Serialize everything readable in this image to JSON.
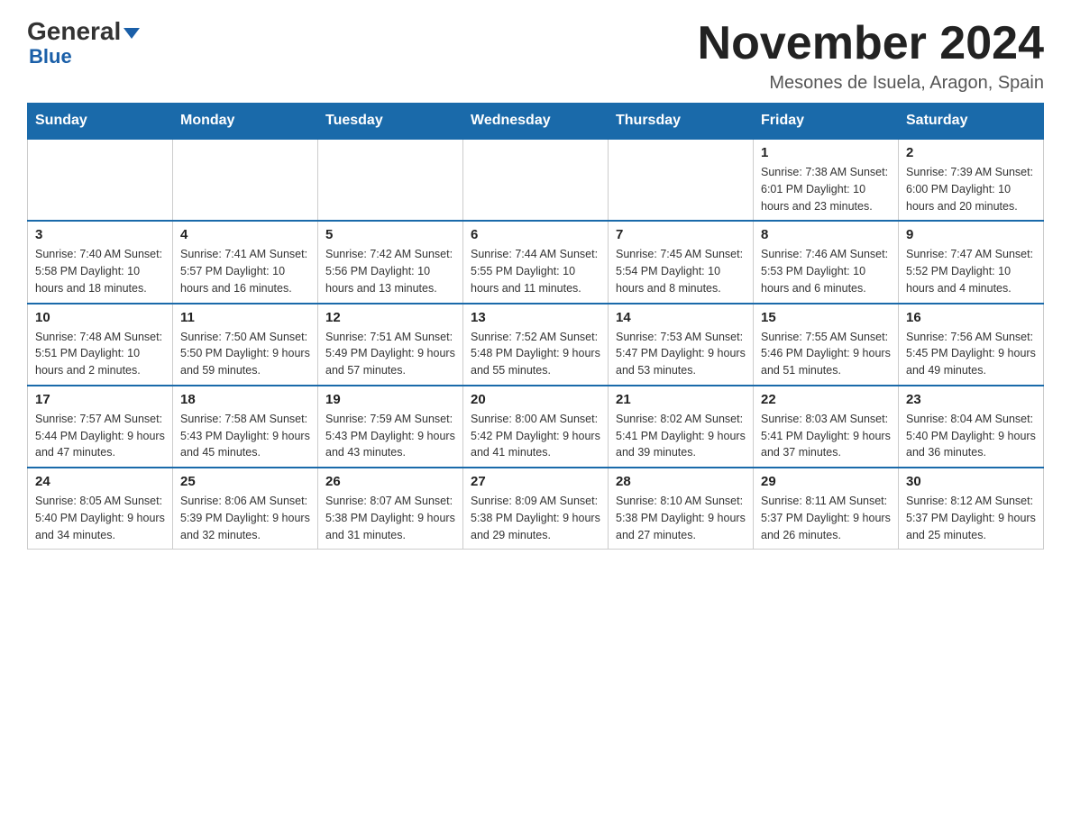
{
  "logo": {
    "top_text": "General",
    "bottom_text": "Blue"
  },
  "title": "November 2024",
  "location": "Mesones de Isuela, Aragon, Spain",
  "days_of_week": [
    "Sunday",
    "Monday",
    "Tuesday",
    "Wednesday",
    "Thursday",
    "Friday",
    "Saturday"
  ],
  "weeks": [
    [
      {
        "day": "",
        "info": ""
      },
      {
        "day": "",
        "info": ""
      },
      {
        "day": "",
        "info": ""
      },
      {
        "day": "",
        "info": ""
      },
      {
        "day": "",
        "info": ""
      },
      {
        "day": "1",
        "info": "Sunrise: 7:38 AM\nSunset: 6:01 PM\nDaylight: 10 hours and 23 minutes."
      },
      {
        "day": "2",
        "info": "Sunrise: 7:39 AM\nSunset: 6:00 PM\nDaylight: 10 hours and 20 minutes."
      }
    ],
    [
      {
        "day": "3",
        "info": "Sunrise: 7:40 AM\nSunset: 5:58 PM\nDaylight: 10 hours and 18 minutes."
      },
      {
        "day": "4",
        "info": "Sunrise: 7:41 AM\nSunset: 5:57 PM\nDaylight: 10 hours and 16 minutes."
      },
      {
        "day": "5",
        "info": "Sunrise: 7:42 AM\nSunset: 5:56 PM\nDaylight: 10 hours and 13 minutes."
      },
      {
        "day": "6",
        "info": "Sunrise: 7:44 AM\nSunset: 5:55 PM\nDaylight: 10 hours and 11 minutes."
      },
      {
        "day": "7",
        "info": "Sunrise: 7:45 AM\nSunset: 5:54 PM\nDaylight: 10 hours and 8 minutes."
      },
      {
        "day": "8",
        "info": "Sunrise: 7:46 AM\nSunset: 5:53 PM\nDaylight: 10 hours and 6 minutes."
      },
      {
        "day": "9",
        "info": "Sunrise: 7:47 AM\nSunset: 5:52 PM\nDaylight: 10 hours and 4 minutes."
      }
    ],
    [
      {
        "day": "10",
        "info": "Sunrise: 7:48 AM\nSunset: 5:51 PM\nDaylight: 10 hours and 2 minutes."
      },
      {
        "day": "11",
        "info": "Sunrise: 7:50 AM\nSunset: 5:50 PM\nDaylight: 9 hours and 59 minutes."
      },
      {
        "day": "12",
        "info": "Sunrise: 7:51 AM\nSunset: 5:49 PM\nDaylight: 9 hours and 57 minutes."
      },
      {
        "day": "13",
        "info": "Sunrise: 7:52 AM\nSunset: 5:48 PM\nDaylight: 9 hours and 55 minutes."
      },
      {
        "day": "14",
        "info": "Sunrise: 7:53 AM\nSunset: 5:47 PM\nDaylight: 9 hours and 53 minutes."
      },
      {
        "day": "15",
        "info": "Sunrise: 7:55 AM\nSunset: 5:46 PM\nDaylight: 9 hours and 51 minutes."
      },
      {
        "day": "16",
        "info": "Sunrise: 7:56 AM\nSunset: 5:45 PM\nDaylight: 9 hours and 49 minutes."
      }
    ],
    [
      {
        "day": "17",
        "info": "Sunrise: 7:57 AM\nSunset: 5:44 PM\nDaylight: 9 hours and 47 minutes."
      },
      {
        "day": "18",
        "info": "Sunrise: 7:58 AM\nSunset: 5:43 PM\nDaylight: 9 hours and 45 minutes."
      },
      {
        "day": "19",
        "info": "Sunrise: 7:59 AM\nSunset: 5:43 PM\nDaylight: 9 hours and 43 minutes."
      },
      {
        "day": "20",
        "info": "Sunrise: 8:00 AM\nSunset: 5:42 PM\nDaylight: 9 hours and 41 minutes."
      },
      {
        "day": "21",
        "info": "Sunrise: 8:02 AM\nSunset: 5:41 PM\nDaylight: 9 hours and 39 minutes."
      },
      {
        "day": "22",
        "info": "Sunrise: 8:03 AM\nSunset: 5:41 PM\nDaylight: 9 hours and 37 minutes."
      },
      {
        "day": "23",
        "info": "Sunrise: 8:04 AM\nSunset: 5:40 PM\nDaylight: 9 hours and 36 minutes."
      }
    ],
    [
      {
        "day": "24",
        "info": "Sunrise: 8:05 AM\nSunset: 5:40 PM\nDaylight: 9 hours and 34 minutes."
      },
      {
        "day": "25",
        "info": "Sunrise: 8:06 AM\nSunset: 5:39 PM\nDaylight: 9 hours and 32 minutes."
      },
      {
        "day": "26",
        "info": "Sunrise: 8:07 AM\nSunset: 5:38 PM\nDaylight: 9 hours and 31 minutes."
      },
      {
        "day": "27",
        "info": "Sunrise: 8:09 AM\nSunset: 5:38 PM\nDaylight: 9 hours and 29 minutes."
      },
      {
        "day": "28",
        "info": "Sunrise: 8:10 AM\nSunset: 5:38 PM\nDaylight: 9 hours and 27 minutes."
      },
      {
        "day": "29",
        "info": "Sunrise: 8:11 AM\nSunset: 5:37 PM\nDaylight: 9 hours and 26 minutes."
      },
      {
        "day": "30",
        "info": "Sunrise: 8:12 AM\nSunset: 5:37 PM\nDaylight: 9 hours and 25 minutes."
      }
    ]
  ]
}
